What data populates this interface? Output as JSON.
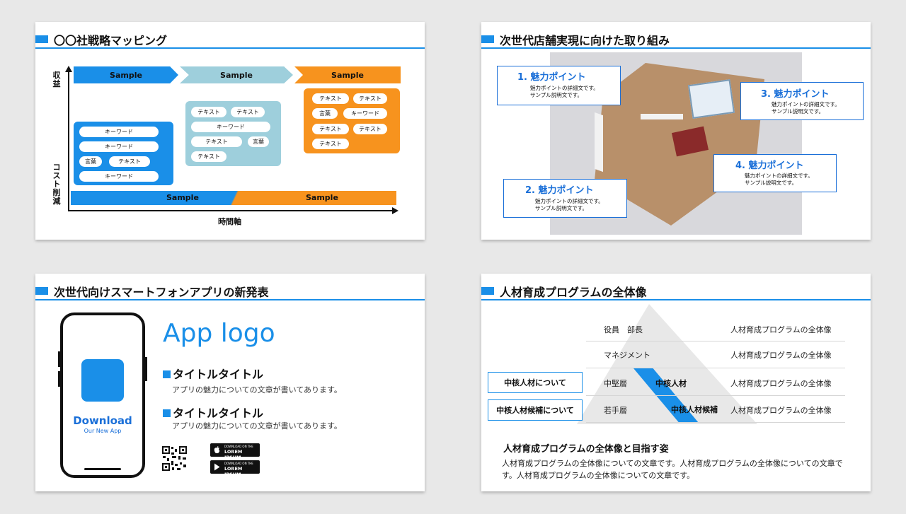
{
  "slide1": {
    "title": "〇〇社戦略マッピング",
    "y_axis_top": "収益",
    "y_axis_bottom": "コスト削減",
    "x_axis": "時間軸",
    "chevrons": [
      "Sample",
      "Sample",
      "Sample"
    ],
    "bottom_labels": [
      "Sample",
      "Sample"
    ],
    "box1": [
      "キーワード",
      "キーワード",
      "言葉",
      "テキスト",
      "キーワード"
    ],
    "box2": [
      "テキスト",
      "テキスト",
      "キーワード",
      "テキスト",
      "言葉",
      "テキスト"
    ],
    "box3": [
      "テキスト",
      "テキスト",
      "言葉",
      "キーワード",
      "テキスト",
      "テキスト",
      "テキスト"
    ],
    "colors": {
      "blue": "#1a8fe8",
      "light_blue": "#9ecfdc",
      "orange": "#f7931e"
    }
  },
  "slide2": {
    "title": "次世代店舗実現に向けた取り組み",
    "points": [
      {
        "title": "1. 魅力ポイント",
        "line1": "魅力ポイントの詳細文です。",
        "line2": "サンプル説明文です。"
      },
      {
        "title": "2. 魅力ポイント",
        "line1": "魅力ポイントの詳細文です。",
        "line2": "サンプル説明文です。"
      },
      {
        "title": "3. 魅力ポイント",
        "line1": "魅力ポイントの詳細文です。",
        "line2": "サンプル説明文です。"
      },
      {
        "title": "4. 魅力ポイント",
        "line1": "魅力ポイントの詳細文です。",
        "line2": "サンプル説明文です。"
      }
    ]
  },
  "slide3": {
    "title": "次世代向けスマートフォンアプリの新発表",
    "download": "Download",
    "download_sub": "Our New App",
    "app_logo": "App logo",
    "features": [
      {
        "title": "タイトルタイトル",
        "desc": "アプリの魅力についての文章が書いてあります。"
      },
      {
        "title": "タイトルタイトル",
        "desc": "アプリの魅力についての文章が書いてあります。"
      }
    ],
    "stores": [
      {
        "small": "DOWNLOAD ON THE",
        "name": "LOREM IPSUM",
        "icon": "apple-icon"
      },
      {
        "small": "DOWNLOAD ON THE",
        "name": "LOREM IPSUM",
        "icon": "play-icon"
      }
    ]
  },
  "slide4": {
    "title": "人材育成プログラムの全体像",
    "levels": [
      "役員　部長",
      "マネジメント",
      "中堅層",
      "若手層"
    ],
    "descs": [
      "人材育成プログラムの全体像",
      "人材育成プログラムの全体像",
      "人材育成プログラムの全体像",
      "人材育成プログラムの全体像"
    ],
    "core": "中核人材",
    "core_candidate": "中核人材候補",
    "side_boxes": [
      "中核人材について",
      "中核人材候補について"
    ],
    "subtitle": "人材育成プログラムの全体像と目指す姿",
    "body": "人材育成プログラムの全体像についての文章です。人材育成プログラムの全体像についての文章です。人材育成プログラムの全体像についての文章です。"
  }
}
